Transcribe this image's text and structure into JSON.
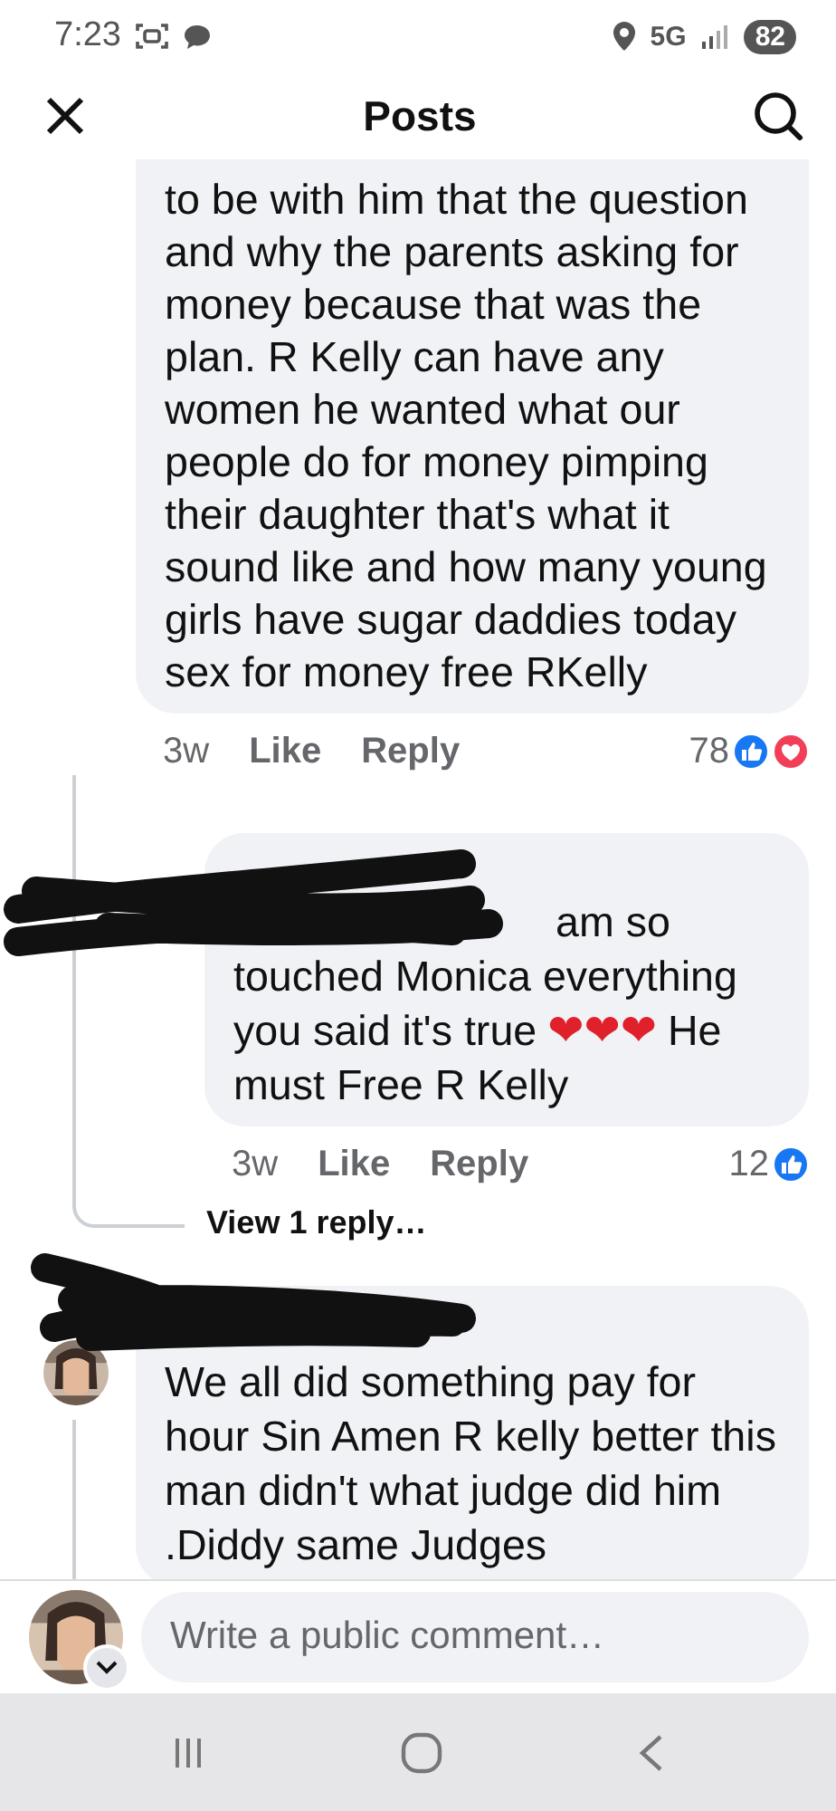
{
  "status_bar": {
    "time": "7:23",
    "network": "5G",
    "battery": "82"
  },
  "header": {
    "title": "Posts"
  },
  "comments": [
    {
      "text": "to be with him that the question and why the parents asking for money because that was the plan. R Kelly can have any women he wanted what our people do for money pimping their daughter  that's what it sound like and how many young girls have sugar daddies today sex for money free RKelly",
      "time": "3w",
      "like": "Like",
      "reply": "Reply",
      "reaction_count": "78",
      "reactions": [
        {
          "kind": "like"
        },
        {
          "kind": "love"
        }
      ],
      "replies": [
        {
          "text_before": "am so touched Monica everything you said it's true",
          "emoji": [
            "❤",
            "❤",
            "❤"
          ],
          "text_after": "He must Free R Kelly",
          "time": "3w",
          "like": "Like",
          "reply": "Reply",
          "reaction_count": "12",
          "reactions": [
            {
              "kind": "like"
            }
          ]
        }
      ],
      "view_replies": "View 1 reply…"
    },
    {
      "text": "We all did something pay for hour Sin Amen R kelly better this man didn't what judge did him .Diddy same Judges"
    }
  ],
  "composer": {
    "placeholder": "Write a public comment…"
  }
}
